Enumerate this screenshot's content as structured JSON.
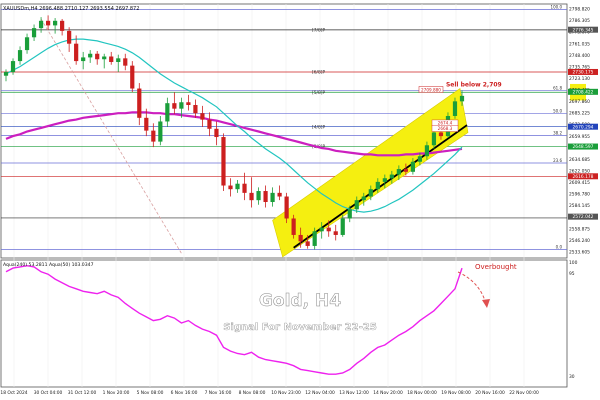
{
  "header": {
    "symbol_line": "XAUUSDm,H4  2696.488 2710.127 2693.554 2697.872"
  },
  "colors": {
    "bull": "#1a9e3a",
    "bear": "#cc1f1f",
    "ma_fast": "#22c5c0",
    "ma_slow": "#cc1fbf",
    "channel": "#f5ef10",
    "oscillator": "#ee22ee",
    "arrow": "#e05050"
  },
  "overlay": {
    "title": "Gold, H4",
    "subtitle": "Signal For November 22-25"
  },
  "chart_data": [
    {
      "type": "candlestick",
      "title": "",
      "ylim": [
        2529,
        2800
      ],
      "y_ticks": [
        "2798.820",
        "2786.305",
        "2773.670",
        "2761.035",
        "2748.400",
        "2735.765",
        "2723.130",
        "2710.495",
        "2697.860",
        "2685.225",
        "2672.590",
        "2659.955",
        "2647.320",
        "2634.685",
        "2622.050",
        "2609.415",
        "2596.780",
        "2584.145",
        "2571.510",
        "2558.875",
        "2546.240",
        "2533.605"
      ],
      "x_labels": [
        "18 Oct 2024",
        "30 Oct 04:00",
        "31 Oct 12:00",
        "1 Nov 20:00",
        "5 Nov 08:00",
        "6 Nov 16:00",
        "7 Nov 16:00",
        "8 Nov 08:00",
        "10 Nov 23:00",
        "12 Nov 04:00",
        "13 Nov 12:00",
        "14 Nov 20:00",
        "18 Nov 00:00",
        "19 Nov 08:00",
        "20 Nov 16:00",
        "22 Nov 00:00"
      ],
      "candles": [
        [
          2726,
          2733,
          2720,
          2730
        ],
        [
          2730,
          2745,
          2727,
          2742
        ],
        [
          2742,
          2758,
          2738,
          2754
        ],
        [
          2754,
          2772,
          2750,
          2768
        ],
        [
          2768,
          2782,
          2764,
          2778
        ],
        [
          2778,
          2790,
          2773,
          2786
        ],
        [
          2786,
          2792,
          2776,
          2781
        ],
        [
          2781,
          2789,
          2772,
          2786
        ],
        [
          2786,
          2788,
          2770,
          2775
        ],
        [
          2775,
          2779,
          2752,
          2761
        ],
        [
          2761,
          2770,
          2738,
          2742
        ],
        [
          2742,
          2752,
          2733,
          2746
        ],
        [
          2746,
          2754,
          2740,
          2750
        ],
        [
          2750,
          2753,
          2738,
          2744
        ],
        [
          2744,
          2750,
          2734,
          2747
        ],
        [
          2747,
          2752,
          2738,
          2741
        ],
        [
          2741,
          2749,
          2730,
          2745
        ],
        [
          2745,
          2750,
          2732,
          2737
        ],
        [
          2737,
          2742,
          2708,
          2712
        ],
        [
          2712,
          2718,
          2672,
          2680
        ],
        [
          2680,
          2690,
          2660,
          2666
        ],
        [
          2666,
          2674,
          2648,
          2654
        ],
        [
          2654,
          2682,
          2650,
          2676
        ],
        [
          2676,
          2702,
          2670,
          2696
        ],
        [
          2696,
          2708,
          2684,
          2690
        ],
        [
          2690,
          2702,
          2680,
          2697
        ],
        [
          2697,
          2705,
          2688,
          2694
        ],
        [
          2694,
          2700,
          2680,
          2685
        ],
        [
          2685,
          2693,
          2670,
          2678
        ],
        [
          2678,
          2686,
          2660,
          2668
        ],
        [
          2668,
          2676,
          2650,
          2659
        ],
        [
          2659,
          2663,
          2600,
          2606
        ],
        [
          2606,
          2614,
          2594,
          2602
        ],
        [
          2602,
          2612,
          2598,
          2608
        ],
        [
          2608,
          2620,
          2590,
          2598
        ],
        [
          2598,
          2615,
          2582,
          2590
        ],
        [
          2590,
          2604,
          2585,
          2600
        ],
        [
          2600,
          2606,
          2582,
          2588
        ],
        [
          2588,
          2604,
          2583,
          2598
        ],
        [
          2598,
          2606,
          2590,
          2594
        ],
        [
          2594,
          2598,
          2565,
          2570
        ],
        [
          2570,
          2574,
          2548,
          2552
        ],
        [
          2552,
          2560,
          2538,
          2545
        ],
        [
          2545,
          2552,
          2537,
          2540
        ],
        [
          2540,
          2560,
          2536,
          2556
        ],
        [
          2556,
          2566,
          2548,
          2560
        ],
        [
          2560,
          2568,
          2550,
          2556
        ],
        [
          2556,
          2563,
          2546,
          2552
        ],
        [
          2552,
          2574,
          2550,
          2570
        ],
        [
          2570,
          2584,
          2566,
          2580
        ],
        [
          2580,
          2594,
          2576,
          2590
        ],
        [
          2590,
          2598,
          2584,
          2594
        ],
        [
          2594,
          2606,
          2590,
          2602
        ],
        [
          2602,
          2614,
          2598,
          2610
        ],
        [
          2610,
          2618,
          2603,
          2614
        ],
        [
          2614,
          2622,
          2608,
          2618
        ],
        [
          2618,
          2628,
          2612,
          2624
        ],
        [
          2624,
          2630,
          2617,
          2621
        ],
        [
          2621,
          2636,
          2618,
          2632
        ],
        [
          2632,
          2642,
          2628,
          2638
        ],
        [
          2638,
          2654,
          2634,
          2650
        ],
        [
          2650,
          2668,
          2646,
          2664
        ],
        [
          2664,
          2672,
          2656,
          2660
        ],
        [
          2660,
          2686,
          2658,
          2682
        ],
        [
          2682,
          2702,
          2679,
          2698
        ],
        [
          2698,
          2710,
          2693,
          2704
        ]
      ],
      "ma_fast": [
        2728,
        2732,
        2736,
        2741,
        2746,
        2751,
        2756,
        2760,
        2763,
        2765,
        2766,
        2766,
        2765,
        2764,
        2762,
        2760,
        2758,
        2755,
        2751,
        2746,
        2740,
        2734,
        2728,
        2723,
        2718,
        2714,
        2710,
        2706,
        2702,
        2697,
        2692,
        2685,
        2678,
        2671,
        2665,
        2658,
        2652,
        2646,
        2641,
        2636,
        2630,
        2623,
        2616,
        2609,
        2603,
        2597,
        2592,
        2587,
        2583,
        2580,
        2578,
        2577,
        2578,
        2580,
        2583,
        2587,
        2591,
        2596,
        2601,
        2607,
        2613,
        2619,
        2626,
        2633,
        2640,
        2648
      ],
      "ma_slow": [
        2657,
        2660,
        2662,
        2665,
        2667,
        2669,
        2671,
        2673,
        2675,
        2677,
        2678,
        2680,
        2681,
        2682,
        2683,
        2684,
        2685,
        2685,
        2686,
        2686,
        2686,
        2685,
        2685,
        2684,
        2684,
        2683,
        2682,
        2681,
        2680,
        2678,
        2677,
        2675,
        2673,
        2671,
        2669,
        2667,
        2665,
        2663,
        2661,
        2659,
        2657,
        2655,
        2653,
        2651,
        2649,
        2647,
        2646,
        2644,
        2643,
        2642,
        2641,
        2640,
        2640,
        2639,
        2639,
        2639,
        2639,
        2640,
        2640,
        2641,
        2641,
        2642,
        2643,
        2644,
        2645,
        2646
      ],
      "horizontal_levels": [
        {
          "price": 2798.5,
          "label": "100.0",
          "color": "#6a6fd6",
          "tag": ""
        },
        {
          "price": 2776.1,
          "label": "",
          "color": "#2a2a2a",
          "tag": "[7/8]P"
        },
        {
          "price": 2730.1,
          "label": "",
          "color": "#cc2222",
          "tag": "[6/8]P"
        },
        {
          "price": 2709.8,
          "label": "61.8",
          "color": "#6a6fd6",
          "tag": ""
        },
        {
          "price": 2707.9,
          "label": "",
          "color": "#1a9e3a",
          "tag": "[5/8]P"
        },
        {
          "price": 2684.9,
          "label": "50.0",
          "color": "#6a6fd6",
          "tag": ""
        },
        {
          "price": 2670.3,
          "label": "",
          "color": "#2244bb",
          "tag": "[4/8]P"
        },
        {
          "price": 2660.8,
          "label": "38.2",
          "color": "#6a6fd6",
          "tag": ""
        },
        {
          "price": 2648.6,
          "label": "",
          "color": "#1a9e3a",
          "tag": "[3/8]P"
        },
        {
          "price": 2630.6,
          "label": "23.6",
          "color": "#6a6fd6",
          "tag": ""
        },
        {
          "price": 2616.1,
          "label": "",
          "color": "#cc2222",
          "tag": ""
        },
        {
          "price": 2570.6,
          "label": "",
          "color": "#2a2a2a",
          "tag": ""
        },
        {
          "price": 2536.1,
          "label": "0.0",
          "color": "#6a6fd6",
          "tag": ""
        }
      ],
      "price_tags": [
        {
          "price": 2776.3,
          "text": "2776.345",
          "color": "#555555"
        },
        {
          "price": 2730.1,
          "text": "2730.175",
          "color": "#cc2222"
        },
        {
          "price": 2708.4,
          "text": "2708.422",
          "color": "#1a9e3a"
        },
        {
          "price": 2670.3,
          "text": "2670.294",
          "color": "#2244bb"
        },
        {
          "price": 2648.6,
          "text": "2648.597",
          "color": "#1a9e3a"
        },
        {
          "price": 2616.1,
          "text": "2616.178",
          "color": "#cc2222"
        },
        {
          "price": 2572.0,
          "text": "2572.042",
          "color": "#555555"
        }
      ],
      "chart_labels": [
        {
          "price": 2674.4,
          "text": "2674.4",
          "color": "#cc2222"
        },
        {
          "price": 2668.3,
          "text": "2668.3",
          "color": "#cc2222"
        }
      ],
      "annotations": [
        {
          "text": "2709.880",
          "price": 2709.88
        },
        {
          "text": "Sell below 2,709",
          "price": 2709
        }
      ]
    },
    {
      "type": "line",
      "title": "",
      "indicator_label": "Aqua(240) 53.2811  Aqua(50) 103.0347",
      "ylim": [
        0,
        100
      ],
      "y_ticks": [
        "100",
        "95",
        "30"
      ],
      "series": [
        {
          "name": "",
          "values": [
            92,
            95,
            96,
            97,
            96,
            92,
            90,
            86,
            83,
            80,
            78,
            76,
            75,
            74,
            76,
            73,
            71,
            66,
            62,
            58,
            55,
            52,
            53,
            56,
            54,
            50,
            52,
            48,
            45,
            43,
            40,
            30,
            27,
            25,
            24,
            26,
            22,
            20,
            19,
            18,
            17,
            15,
            12,
            11,
            10,
            9,
            8,
            8,
            9,
            12,
            17,
            21,
            26,
            30,
            32,
            36,
            40,
            43,
            47,
            52,
            56,
            60,
            66,
            72,
            78,
            95
          ]
        }
      ]
    }
  ],
  "annotations": {
    "overbought": "Overbought"
  }
}
